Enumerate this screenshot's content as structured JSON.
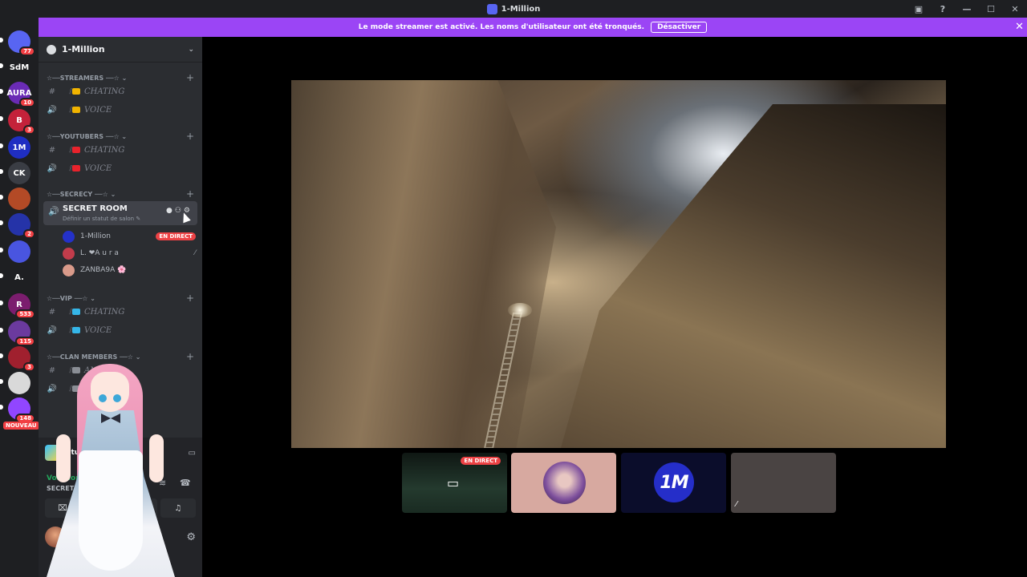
{
  "window": {
    "title": "1-Million"
  },
  "streamer_bar": {
    "message": "Le mode streamer est activé. Les noms d'utilisateur ont été tronqués.",
    "button": "Désactiver"
  },
  "guilds": [
    {
      "label": "",
      "badge": "77",
      "color": "#5865f2"
    },
    {
      "label": "SdM",
      "badge": "",
      "color": "#1e1f22"
    },
    {
      "label": "AURA",
      "badge": "10",
      "color": "#6a2bb5"
    },
    {
      "label": "B",
      "badge": "3",
      "color": "#c4223a"
    },
    {
      "label": "1M",
      "badge": "",
      "color": "#1f2ec2"
    },
    {
      "label": "CK",
      "badge": "",
      "color": "#3a3d44"
    },
    {
      "label": "",
      "badge": "",
      "color": "#b34a26"
    },
    {
      "label": "",
      "badge": "2",
      "color": "#2533a8"
    },
    {
      "label": "",
      "badge": "",
      "color": "#4955e0"
    },
    {
      "label": "A.",
      "badge": "",
      "color": "#1e1f22"
    },
    {
      "label": "R",
      "badge": "533",
      "color": "#7b1d6e"
    },
    {
      "label": "",
      "badge": "115",
      "color": "#6b3a9e"
    },
    {
      "label": "",
      "badge": "3",
      "color": "#a0202e"
    },
    {
      "label": "",
      "badge": "",
      "color": "#d9d9d9"
    },
    {
      "label": "",
      "badge": "148",
      "color": "#9146ff"
    }
  ],
  "nouveau_label": "NOUVEAU",
  "server": {
    "name": "1-Million"
  },
  "categories": [
    {
      "label": "☆──STREAMERS ──☆ ⌄",
      "channels": [
        {
          "icon": "#",
          "name": "CHATING",
          "emoji_color": "#f2b400"
        },
        {
          "icon": "🔊",
          "name": "VOICE",
          "emoji_color": "#f2b400"
        }
      ]
    },
    {
      "label": "☆──YOUTUBERS ──☆ ⌄",
      "channels": [
        {
          "icon": "#",
          "name": "CHATING",
          "emoji_color": "#e8232c"
        },
        {
          "icon": "🔊",
          "name": "VOICE",
          "emoji_color": "#e8232c"
        }
      ]
    },
    {
      "label": "☆──SECRECY ──☆ ⌄"
    },
    {
      "label": "☆──VIP ──☆ ⌄",
      "channels": [
        {
          "icon": "#",
          "name": "CHATING",
          "emoji_color": "#35b6e8"
        },
        {
          "icon": "🔊",
          "name": "VOICE",
          "emoji_color": "#35b6e8"
        }
      ]
    },
    {
      "label": "☆──CLAN MEMBERS ──☆ ⌄",
      "channels": [
        {
          "icon": "#",
          "name": "AN",
          "emoji_color": "#8a8e95"
        },
        {
          "icon": "🔊",
          "name": "AN",
          "emoji_color": "#8a8e95"
        }
      ]
    }
  ],
  "secret_room": {
    "name": "SECRET ROOM",
    "status_hint": "Définir un statut de salon ✎",
    "members": [
      {
        "name": "1-Million",
        "tag": "EN DIRECT",
        "avatar_color": "#2431c9"
      },
      {
        "name": "L. ❤A u r a",
        "tag": "",
        "avatar_color": "#c23c4b"
      },
      {
        "name": "ZANBA9A 🌸",
        "tag": "",
        "avatar_color": "#d99a8a"
      }
    ]
  },
  "activity": {
    "game": "Stumble Guys"
  },
  "voice": {
    "status": "Voix connectée",
    "channel": "SECRET ROOM /"
  },
  "stage": {
    "tiles": [
      {
        "kind": "stream",
        "label": "EN DIRECT",
        "bg": "#1d2a22"
      },
      {
        "kind": "avatar",
        "label": "",
        "bg": "#d7a9a0"
      },
      {
        "kind": "logo",
        "label": "1M",
        "bg": "#0b0d2b"
      },
      {
        "kind": "muted",
        "label": "",
        "bg": "#4a4443"
      }
    ]
  },
  "accent": "#9b45f5"
}
